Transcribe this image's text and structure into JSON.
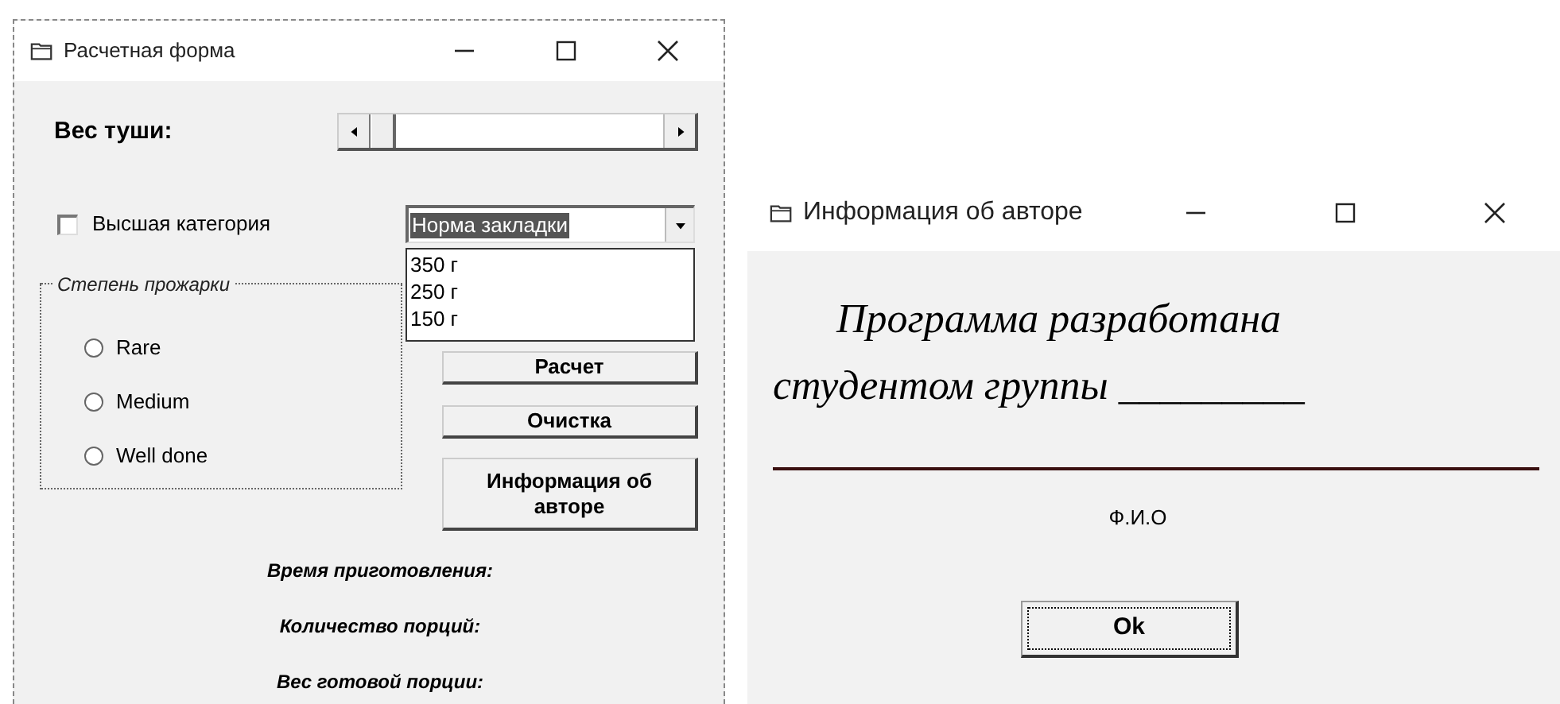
{
  "main_window": {
    "title": "Расчетная форма",
    "weight_label": "Вес туши:",
    "weight_scrollbar": {
      "level": 0
    },
    "premium_checkbox": {
      "label": "Высшая категория",
      "checked": false
    },
    "portion_combo": {
      "value": "Норма закладки",
      "options": [
        "350 г",
        "250 г",
        "150 г"
      ]
    },
    "doneness_group": {
      "legend": "Степень прожарки",
      "options": [
        {
          "label": "Rare",
          "selected": false
        },
        {
          "label": "Medium",
          "selected": false
        },
        {
          "label": "Well done",
          "selected": false
        }
      ]
    },
    "buttons": [
      "Расчет",
      "Очистка",
      "Информация об авторе"
    ],
    "results": [
      "Время приготовления:",
      "Количество порций:",
      "Вес готовой порции:"
    ]
  },
  "author_window": {
    "title": "Информация об авторе",
    "heading": [
      "Программа разработана",
      "студентом группы _________"
    ],
    "caption": "Ф.И.О",
    "ok_button": "Ok"
  }
}
